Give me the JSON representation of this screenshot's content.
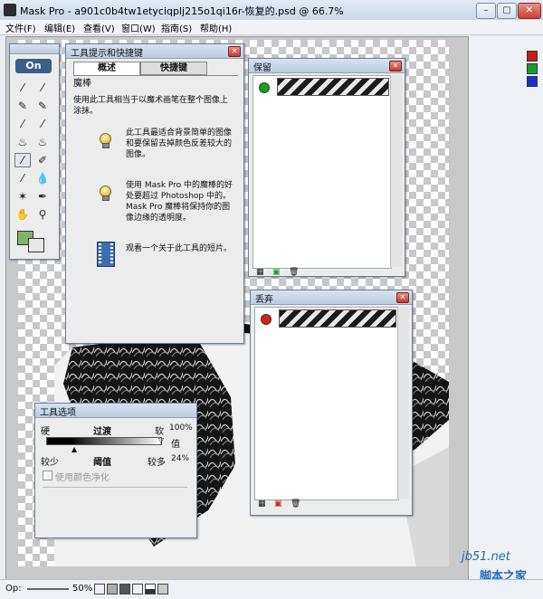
{
  "window": {
    "title": "Mask Pro - a901c0b4tw1etyciqplj215o1qi16r-恢复的.psd @ 66.7%",
    "min": "–",
    "max": "▢",
    "close": "✕"
  },
  "menu": [
    "文件(F)",
    "编辑(E)",
    "查看(V)",
    "窗口(W)",
    "指南(S)",
    "帮助(H)"
  ],
  "toolbox": {
    "logo": "On"
  },
  "tips_panel": {
    "title": "工具提示和快捷键",
    "tab_overview": "概述",
    "tab_shortcuts": "快捷键",
    "tool_name": "魔棒",
    "description": "使用此工具相当于以魔术画笔在整个图像上涂抹。",
    "tip1": "此工具最适合背景简单的图像和要保留去掉颜色反差较大的图像。",
    "tip2": "使用 Mask Pro 中的魔棒的好处要超过 Photoshop 中的。Mask Pro 魔棒将保持你的图像边缘的透明度。",
    "tip3": "观看一个关于此工具的短片。"
  },
  "keep_panel": {
    "title": "保留"
  },
  "drop_panel": {
    "title": "丢弃"
  },
  "tool_options": {
    "title": "工具选项",
    "hard": "硬",
    "feather": "过渡",
    "soft": "软",
    "soft_pct": "100%",
    "value_label": "值",
    "less": "较少",
    "threshold": "阈值",
    "more": "较多",
    "more_pct": "24%",
    "color_purify": "使用颜色净化"
  },
  "status": {
    "op_label": "Op:",
    "zoom": "50%"
  },
  "watermark": {
    "site": "jb51.net",
    "name": "脚本之家"
  },
  "colors": {
    "close_red": "#c8402f",
    "panel_border": "#6d7f98",
    "swatch_red": "#c81a1a",
    "swatch_green": "#1a9a2a",
    "swatch_blue": "#1a2fc8"
  }
}
